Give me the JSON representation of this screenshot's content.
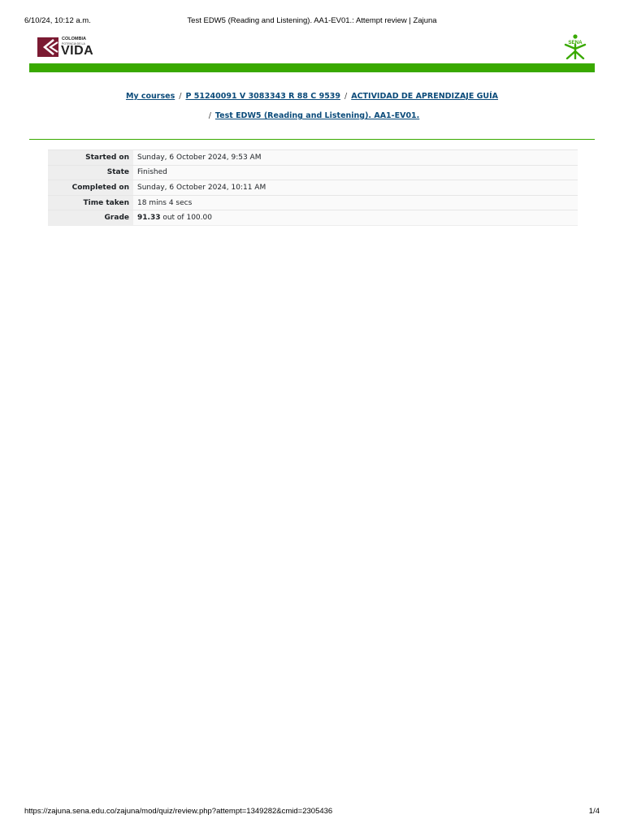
{
  "print_header": {
    "date": "6/10/24, 10:12 a.m.",
    "title": "Test EDW5 (Reading and Listening). AA1-EV01.: Attempt review | Zajuna"
  },
  "logos": {
    "colombia_line1": "COLOMBIA",
    "colombia_line2": "POTENCIA DE LA",
    "colombia_line3": "VIDA",
    "sena": "SENA",
    "brand_color": "#39a900",
    "colombia_mark_color": "#7b1a32"
  },
  "breadcrumb": {
    "items": [
      {
        "label": "My courses"
      },
      {
        "label": "P 51240091 V 3083343 R 88 C 9539"
      },
      {
        "label": "ACTIVIDAD DE APRENDIZAJE GUÍA"
      },
      {
        "label": "Test EDW5 (Reading and Listening). AA1-EV01."
      }
    ],
    "separator": "/"
  },
  "summary": {
    "rows": [
      {
        "label": "Started on",
        "value": "Sunday, 6 October 2024, 9:53 AM"
      },
      {
        "label": "State",
        "value": "Finished"
      },
      {
        "label": "Completed on",
        "value": "Sunday, 6 October 2024, 10:11 AM"
      },
      {
        "label": "Time taken",
        "value": "18 mins 4 secs"
      }
    ],
    "grade": {
      "label": "Grade",
      "value": "91.33",
      "suffix": " out of 100.00"
    }
  },
  "print_footer": {
    "url": "https://zajuna.sena.edu.co/zajuna/mod/quiz/review.php?attempt=1349282&cmid=2305436",
    "page": "1/4"
  }
}
